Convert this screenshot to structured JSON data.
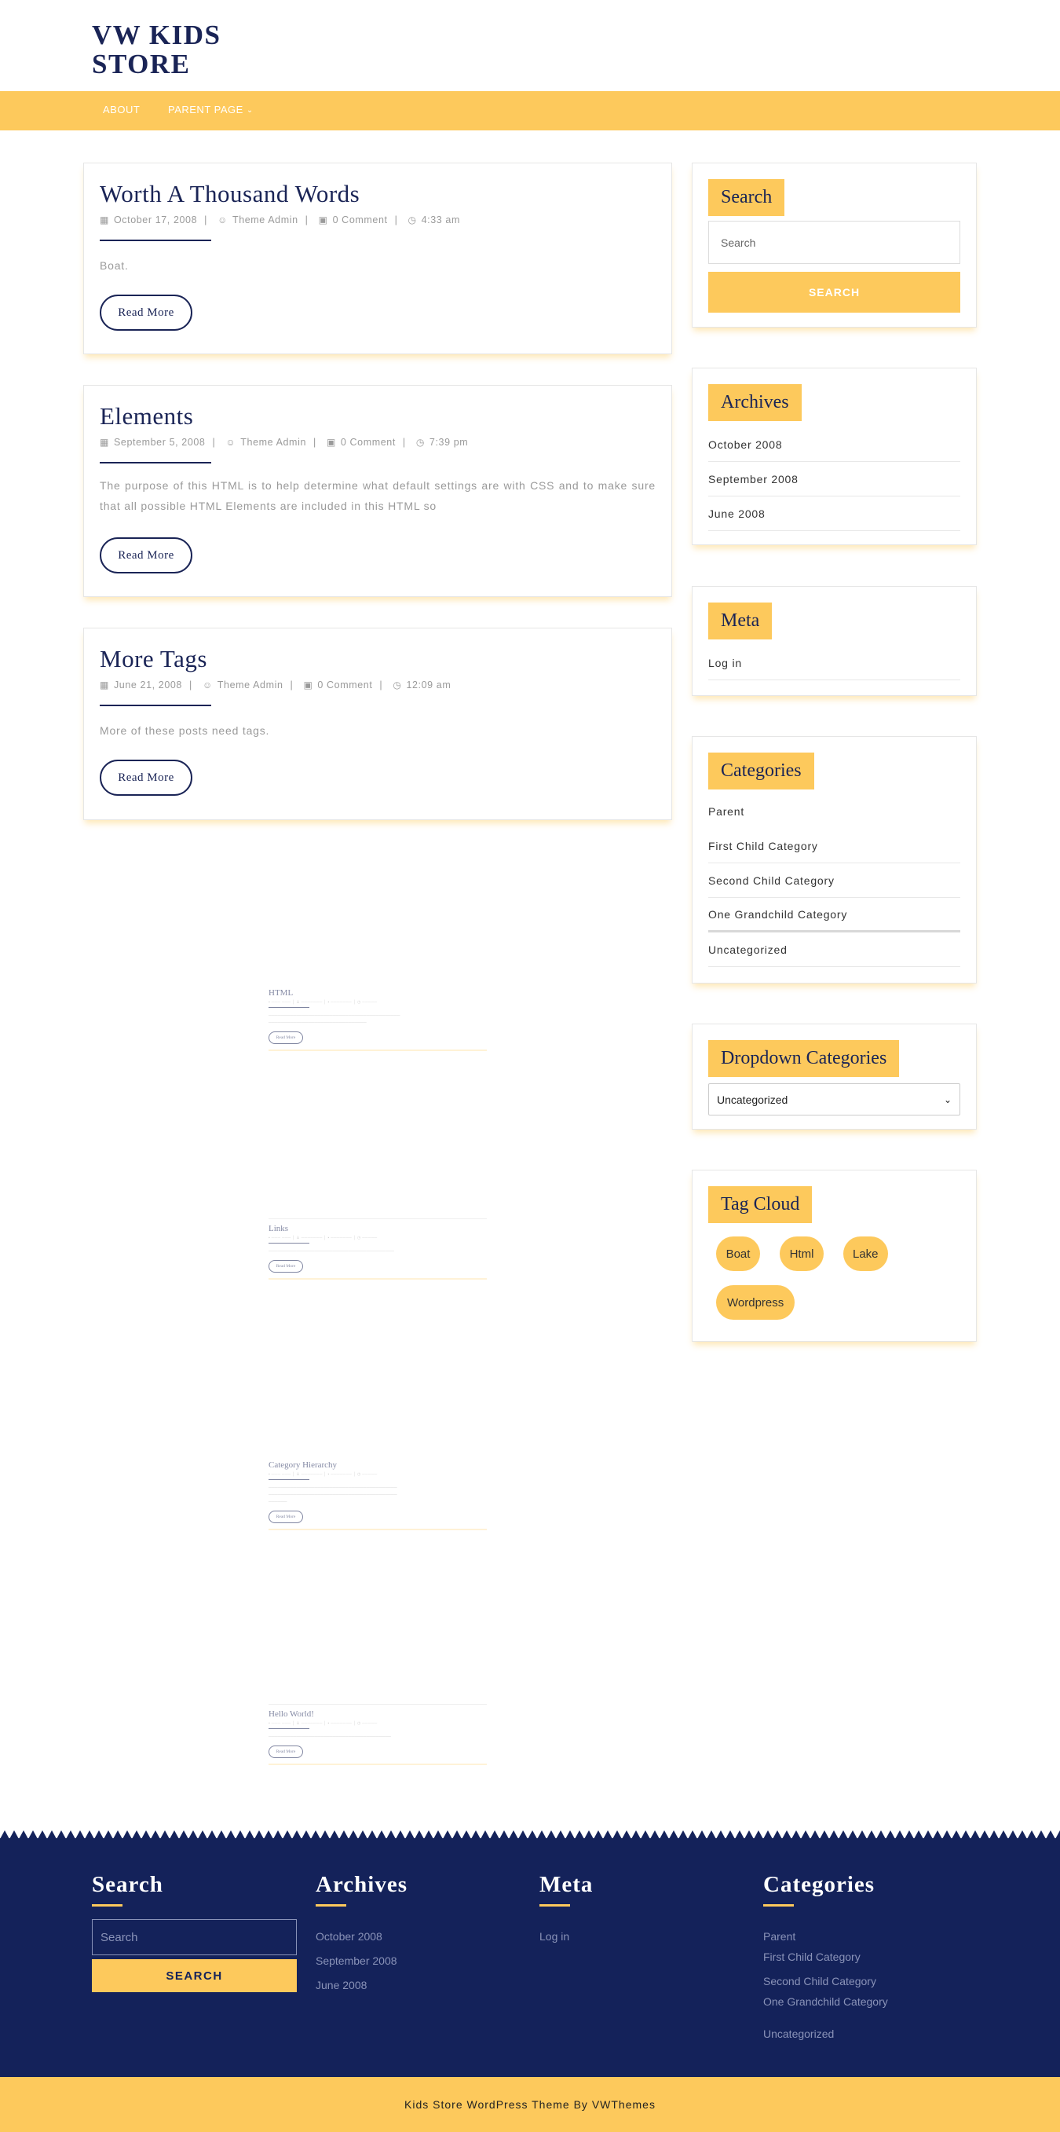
{
  "site": {
    "title": "VW KIDS STORE"
  },
  "nav": {
    "items": [
      "ABOUT",
      "PARENT PAGE"
    ]
  },
  "posts": [
    {
      "title": "Worth A Thousand Words",
      "date": "October 17, 2008",
      "author": "Theme Admin",
      "comments": "0 Comment",
      "time": "4:33 am",
      "excerpt": "Boat.",
      "button": "Read More"
    },
    {
      "title": "Elements",
      "date": "September 5, 2008",
      "author": "Theme Admin",
      "comments": "0 Comment",
      "time": "7:39 pm",
      "excerpt": "The purpose of this HTML is to help determine what default settings are with CSS and to make sure that all possible HTML Elements are included in this HTML so",
      "button": "Read More"
    },
    {
      "title": "More Tags",
      "date": "June 21, 2008",
      "author": "Theme Admin",
      "comments": "0 Comment",
      "time": "12:09 am",
      "excerpt": "More of these posts need tags.",
      "button": "Read More"
    }
  ],
  "mini_posts": [
    {
      "title": "HTML",
      "button": "Read More"
    },
    {
      "title": "Links",
      "button": "Read More"
    },
    {
      "title": "Category Hierarchy",
      "button": "Read More"
    },
    {
      "title": "Hello World!",
      "button": "Read More"
    }
  ],
  "sidebar": {
    "search": {
      "title": "Search",
      "placeholder": "Search",
      "button": "SEARCH"
    },
    "archives": {
      "title": "Archives",
      "items": [
        "October 2008",
        "September 2008",
        "June 2008"
      ]
    },
    "meta": {
      "title": "Meta",
      "items": [
        "Log in"
      ]
    },
    "categories": {
      "title": "Categories",
      "items": [
        "Parent",
        "First Child Category",
        "Second Child Category",
        "One Grandchild Category",
        "Uncategorized"
      ]
    },
    "dropdown": {
      "title": "Dropdown Categories",
      "selected": "Uncategorized"
    },
    "tag_cloud": {
      "title": "Tag Cloud",
      "tags": [
        "Boat",
        "Html",
        "Lake",
        "Wordpress"
      ]
    }
  },
  "footer": {
    "search": {
      "title": "Search",
      "placeholder": "Search",
      "button": "SEARCH"
    },
    "archives": {
      "title": "Archives",
      "items": [
        "October 2008",
        "September 2008",
        "June 2008"
      ]
    },
    "meta": {
      "title": "Meta",
      "items": [
        "Log in"
      ]
    },
    "categories": {
      "title": "Categories",
      "items": [
        "Parent",
        "First Child Category",
        "Second Child Category",
        "One Grandchild Category",
        "Uncategorized"
      ]
    },
    "copyright": "Kids Store WordPress Theme By VWThemes"
  },
  "colors": {
    "accent": "#fdc95c",
    "navy": "#14225a",
    "text_navy": "#1a2456"
  }
}
